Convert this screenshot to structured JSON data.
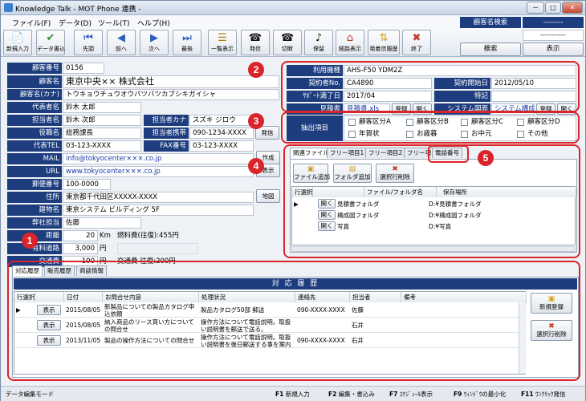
{
  "window": {
    "title": "Knowledge Talk - MOT Phone 連携 -",
    "min_glyph": "－",
    "max_glyph": "□",
    "close_glyph": "✕"
  },
  "menu": [
    "ファイル(F)",
    "データ(D)",
    "ツール(T)",
    "ヘルプ(H)"
  ],
  "toolbar": [
    {
      "label": "新規入力",
      "icon": "new-entry-icon",
      "glyph": "📄"
    },
    {
      "label": "データ書込",
      "icon": "data-write-icon",
      "glyph": "✔"
    },
    {
      "label": "先頭",
      "icon": "first-icon",
      "glyph": "⏮"
    },
    {
      "label": "前へ",
      "icon": "prev-icon",
      "glyph": "◀"
    },
    {
      "label": "次へ",
      "icon": "next-icon",
      "glyph": "▶"
    },
    {
      "label": "最後",
      "icon": "last-icon",
      "glyph": "⏭"
    },
    {
      "label": "一覧表示",
      "icon": "list-view-icon",
      "glyph": "☰"
    },
    {
      "label": "発信",
      "icon": "dial-icon",
      "glyph": "☎"
    },
    {
      "label": "切断",
      "icon": "hangup-icon",
      "glyph": "☎"
    },
    {
      "label": "保留",
      "icon": "hold-icon",
      "glyph": "♪"
    },
    {
      "label": "経路表示",
      "icon": "route-icon",
      "glyph": "⌂"
    },
    {
      "label": "発着信履歴",
      "icon": "call-history-icon",
      "glyph": "⇅"
    },
    {
      "label": "終了",
      "icon": "exit-icon",
      "glyph": "✖"
    }
  ],
  "search": {
    "label": "顧客名検索",
    "dashes1": "--------",
    "dashes2": "-----------",
    "search_btn": "検索",
    "display_btn": "表示"
  },
  "customer": {
    "no_label": "顧客番号",
    "no": "0156",
    "name_label": "顧客名",
    "name": "東京中央×× 株式会社",
    "kana_label": "顧客名(カナ)",
    "kana": "トウキョウチュウオウバツバツカブシキガイシャ",
    "rep_label": "代表者名",
    "rep": "鈴木 太郎",
    "person_label": "担当者名",
    "person": "鈴木 次郎",
    "person_kana_label": "担当者カナ",
    "person_kana": "スズキ ジロウ",
    "position_label": "役職名",
    "position": "総務課長",
    "mobile_label": "担当者携帯",
    "mobile": "090-1234-XXXX",
    "dial_btn": "発信",
    "tel_label": "代表TEL",
    "tel": "03-123-XXXX",
    "fax_label": "FAX番号",
    "fax": "03-123-XXXX",
    "mail_label": "MAIL",
    "mail": "info@tokyocenter×××.co.jp",
    "mail_btn": "作成",
    "url_label": "URL",
    "url": "www.tokyocenter×××.co.jp",
    "url_btn": "表示",
    "zip_label": "郵便番号",
    "zip": "100-0000",
    "addr_label": "住所",
    "addr": "東京都千代田区XXXXX-XXXX",
    "map_btn": "地図",
    "bldg_label": "建物名",
    "bldg": "東京システム ビルディング 5F",
    "staff_label": "弊社担当",
    "staff": "佐藤",
    "distance_label": "距離",
    "distance": "20",
    "distance_unit": "Km",
    "fuel_label": "燃料費(往復):455円",
    "toll_label": "有料道路",
    "toll": "3,000",
    "toll_unit": "円",
    "transport_label": "交通費",
    "transport": "100",
    "transport_unit": "円",
    "transport_note": "交通費 往復:200円"
  },
  "device": {
    "model_label": "利用機種",
    "model": "AHS-F50 YDM2Z",
    "contract_no_label": "契約者No.",
    "contract_no": "CA4890",
    "contract_start_label": "契約開始日",
    "contract_start": "2012/05/10",
    "support_end_label": "ｻﾎﾟｰﾄ満了日",
    "support_end": "2017/04",
    "note_label": "特記",
    "note": "",
    "estimate_label": "見積書",
    "estimate": "見積書.xls",
    "register_btn": "登録",
    "open_btn": "開く",
    "sysfig_label": "システム図面",
    "sysfig": "システム構成",
    "register_btn2": "登録",
    "open_btn2": "開く"
  },
  "extract": {
    "label": "抽出項目",
    "items": [
      "顧客区分A",
      "顧客区分B",
      "顧客区分C",
      "顧客区分D",
      "年賀状",
      "お歳暮",
      "お中元",
      "その他"
    ]
  },
  "files": {
    "tabs": [
      "関連ファイル",
      "フリー項目1",
      "フリー項目2",
      "フリー項目3",
      "電話番号"
    ],
    "buttons": [
      "ファイル追加",
      "フォルダ追加",
      "選択行削除"
    ],
    "columns": [
      "行選択",
      "ファイル/フォルダ名",
      "保存場所"
    ],
    "open_btn": "開く",
    "rows": [
      {
        "name": "見積書フォルダ",
        "path": "D:¥見積書フォルダ"
      },
      {
        "name": "構成図フォルダ",
        "path": "D:¥構成図フォルダ"
      },
      {
        "name": "写真",
        "path": "D:¥写真"
      }
    ]
  },
  "history": {
    "tabs": [
      "対応履歴",
      "販売履歴",
      "商談情報"
    ],
    "banner": "対 応 履 歴",
    "columns": [
      "行選択",
      "日付",
      "お問合せ内容",
      "処理状況",
      "連絡先",
      "担当者",
      "備考"
    ],
    "show_btn": "表示",
    "rows": [
      {
        "date": "2015/08/05",
        "content": "新製品についての製品カタログ申込依頼",
        "status": "製品カタログ50部 郵送",
        "contact": "090-XXXX-XXXX",
        "person": "佐藤",
        "note": ""
      },
      {
        "date": "2015/08/05",
        "content": "納入商品のリース買い方についての問合せ",
        "status": "操作方法について電話説明。取扱い説明書を郵送で送る。",
        "contact": "",
        "person": "石井",
        "note": ""
      },
      {
        "date": "2013/11/05",
        "content": "製品の操作方法についての問合せ",
        "status": "操作方法について電話説明。取扱い説明書を後日郵送する事を案内",
        "contact": "090-XXXX-XXXX",
        "person": "石井",
        "note": ""
      }
    ],
    "add_btn": "新規登録",
    "delete_btn": "選択行削除"
  },
  "badges": [
    "1",
    "2",
    "3",
    "4",
    "5"
  ],
  "status": {
    "mode": "データ編集モード",
    "keys": [
      {
        "key": "F1",
        "label": "新規入力"
      },
      {
        "key": "F2",
        "label": "編集・書込み"
      },
      {
        "key": "F7",
        "label": "ｽｹｼﾞｭｰﾙ表示"
      },
      {
        "key": "F9",
        "label": "ｳｨﾝﾄﾞｳの最小化"
      },
      {
        "key": "F11",
        "label": "ﾜﾝｸﾘｯｸ発信"
      }
    ]
  }
}
